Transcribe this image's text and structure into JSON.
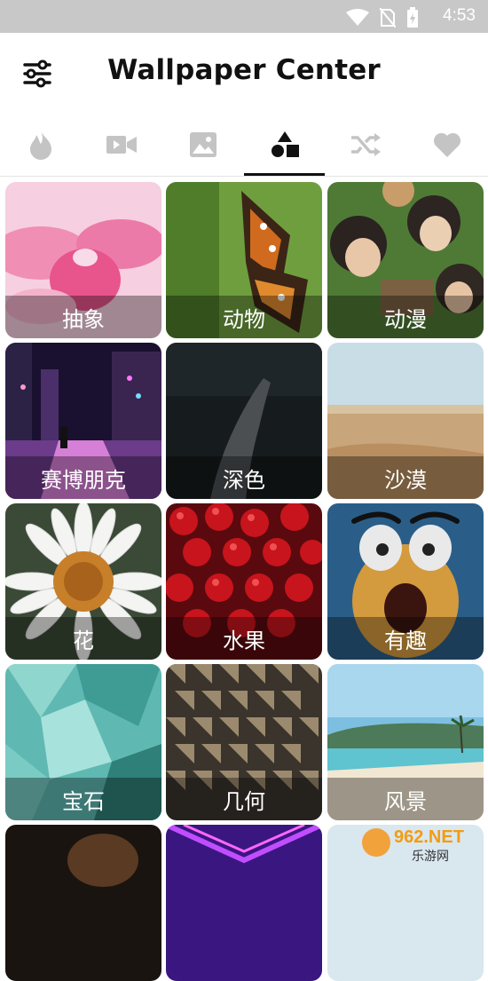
{
  "status": {
    "time": "4:53"
  },
  "appbar": {
    "title": "Wallpaper Center"
  },
  "tabs": [
    {
      "name": "hot",
      "icon": "fire-icon",
      "active": false
    },
    {
      "name": "video",
      "icon": "video-icon",
      "active": false
    },
    {
      "name": "image",
      "icon": "image-icon",
      "active": false
    },
    {
      "name": "category",
      "icon": "shapes-icon",
      "active": true
    },
    {
      "name": "random",
      "icon": "shuffle-icon",
      "active": false
    },
    {
      "name": "favorite",
      "icon": "heart-icon",
      "active": false
    }
  ],
  "categories": [
    {
      "label": "抽象"
    },
    {
      "label": "动物"
    },
    {
      "label": "动漫"
    },
    {
      "label": "赛博朋克"
    },
    {
      "label": "深色"
    },
    {
      "label": "沙漠"
    },
    {
      "label": "花"
    },
    {
      "label": "水果"
    },
    {
      "label": "有趣"
    },
    {
      "label": "宝石"
    },
    {
      "label": "几何"
    },
    {
      "label": "风景"
    }
  ],
  "watermark": {
    "top": "962.NET",
    "bottom": "乐游网"
  },
  "colors": {
    "accent": "#111111",
    "tab_inactive": "#c4c4c4",
    "statusbar": "#c8c8c8"
  }
}
